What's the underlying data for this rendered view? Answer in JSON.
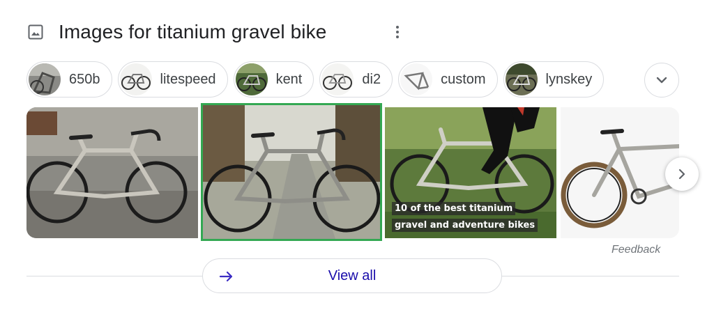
{
  "header": {
    "title": "Images for titanium gravel bike",
    "image_icon": "image-icon",
    "more_icon": "more-vert-icon"
  },
  "chips": [
    {
      "label": "650b"
    },
    {
      "label": "litespeed"
    },
    {
      "label": "kent"
    },
    {
      "label": "di2"
    },
    {
      "label": "custom"
    },
    {
      "label": "lynskey"
    }
  ],
  "expand_icon": "chevron-down-icon",
  "gallery": {
    "images": [
      {
        "caption_lines": []
      },
      {
        "caption_lines": [],
        "selected": true
      },
      {
        "caption_lines": [
          "10 of the best titanium",
          "gravel and adventure bikes"
        ]
      },
      {
        "caption_lines": []
      }
    ],
    "next_icon": "chevron-right-icon"
  },
  "feedback": "Feedback",
  "view_all": {
    "label": "View all",
    "icon": "arrow-right-icon"
  },
  "colors": {
    "selected_border": "#34a853",
    "link": "#1a0dab",
    "border": "#dadce0",
    "arrow": "#3c2dc4"
  }
}
